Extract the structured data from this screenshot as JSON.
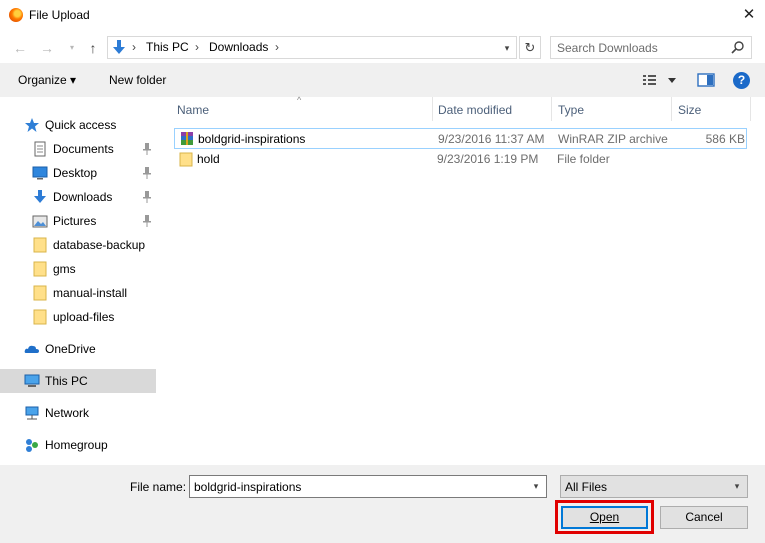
{
  "window": {
    "title": "File Upload",
    "close_label": "✕"
  },
  "address": {
    "crumbs": [
      "This PC",
      "Downloads"
    ],
    "search_placeholder": "Search Downloads"
  },
  "toolbar": {
    "organize_label": "Organize ▾",
    "new_folder_label": "New folder",
    "help_label": "?"
  },
  "nav": {
    "quick_access": "Quick access",
    "items": [
      {
        "label": "Documents",
        "pinned": true
      },
      {
        "label": "Desktop",
        "pinned": true
      },
      {
        "label": "Downloads",
        "pinned": true
      },
      {
        "label": "Pictures",
        "pinned": true
      },
      {
        "label": "database-backup"
      },
      {
        "label": "gms"
      },
      {
        "label": "manual-install"
      },
      {
        "label": "upload-files"
      }
    ],
    "onedrive": "OneDrive",
    "this_pc": "This PC",
    "network": "Network",
    "homegroup": "Homegroup"
  },
  "columns": {
    "name": "Name",
    "date": "Date modified",
    "type": "Type",
    "size": "Size"
  },
  "files": [
    {
      "name": "boldgrid-inspirations",
      "date": "9/23/2016 11:37 AM",
      "type": "WinRAR ZIP archive",
      "size": "586 KB",
      "icon": "winrar-archive-icon"
    },
    {
      "name": "hold",
      "date": "9/23/2016 1:19 PM",
      "type": "File folder",
      "size": "",
      "icon": "folder-icon"
    }
  ],
  "bottom": {
    "file_name_label": "File name:",
    "file_name_value": "boldgrid-inspirations",
    "filter_value": "All Files",
    "open_label": "Open",
    "cancel_label": "Cancel"
  },
  "colors": {
    "accent": "#0078d7",
    "highlight_box": "#e00000",
    "header_text": "#4c607a"
  }
}
